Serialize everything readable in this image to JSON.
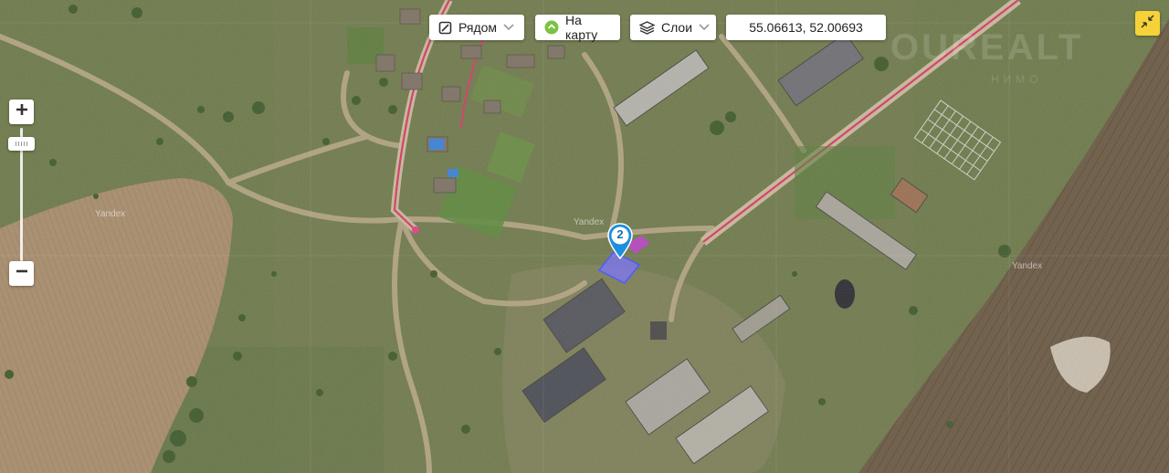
{
  "toolbar": {
    "nearby": {
      "label": "Рядом",
      "icon": "map-fold-icon"
    },
    "to_map": {
      "label": "На карту",
      "icon": "green-circle-arrow-icon"
    },
    "layers": {
      "label": "Слои",
      "icon": "layers-icon"
    },
    "coordinates": "55.06613, 52.00693"
  },
  "zoom": {
    "in_icon": "plus-icon",
    "out_icon": "minus-icon"
  },
  "fullscreen": {
    "icon": "collapse-arrows-icon"
  },
  "marker": {
    "count": "2"
  },
  "watermarks": [
    "Yandex",
    "Yandex",
    "Yandex"
  ],
  "brand": {
    "text": "OUREALT",
    "sub": "НИМО"
  },
  "colors": {
    "accent_yellow": "#f5d238",
    "road_line": "#d63a6a",
    "marker_blue": "#1d8fe0",
    "highlight_plot": "#7a6fff"
  }
}
